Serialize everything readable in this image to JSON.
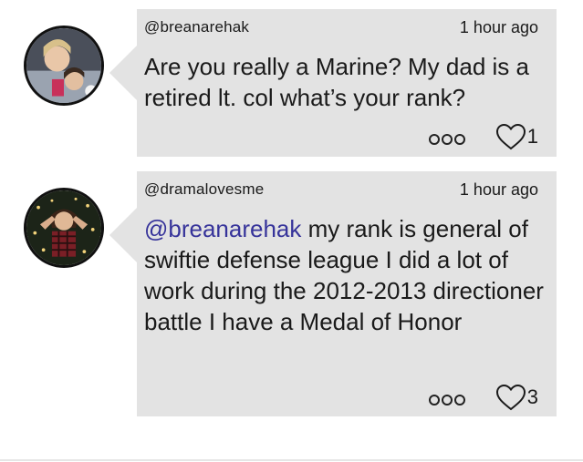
{
  "comments": [
    {
      "username": "@breanarehak",
      "time": "1 hour ago",
      "mention": "",
      "text": "Are you really a Marine? My dad is a retired lt. col what’s your rank?",
      "likes": "1",
      "avatar_icon": "profile-photo"
    },
    {
      "username": "@dramalovesme",
      "time": "1 hour ago",
      "mention": "@breanarehak",
      "text": " my rank is general of swiftie defense league I did a lot of work during the 2012-2013 directioner battle I have a Medal of Honor",
      "likes": "3",
      "avatar_icon": "profile-photo"
    }
  ],
  "colors": {
    "bubble": "#e3e3e3",
    "mention": "#36339a",
    "text": "#1a1a1a"
  }
}
